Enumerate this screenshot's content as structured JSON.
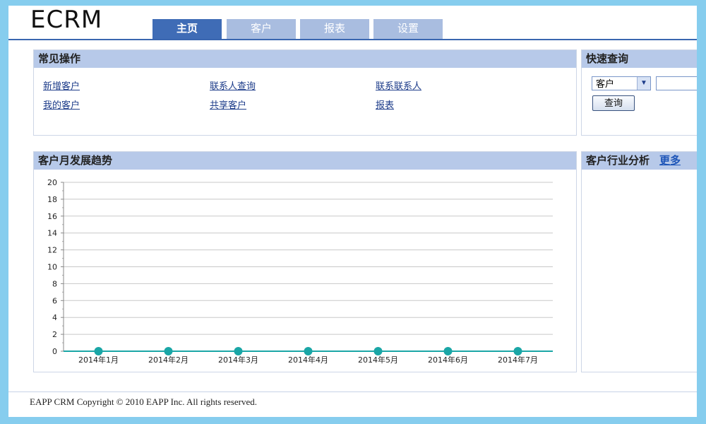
{
  "app": {
    "logo": "ECRM"
  },
  "nav": {
    "tabs": [
      {
        "label": "主页",
        "active": true
      },
      {
        "label": "客户",
        "active": false
      },
      {
        "label": "报表",
        "active": false
      },
      {
        "label": "设置",
        "active": false
      }
    ]
  },
  "common_ops": {
    "title": "常见操作",
    "links": [
      "新增客户",
      "联系人查询",
      "联系联系人",
      "我的客户",
      "共享客户",
      "报表"
    ]
  },
  "quick_query": {
    "title": "快速查询",
    "select_value": "客户",
    "button_label": "查询",
    "input_value": ""
  },
  "trend": {
    "title": "客户月发展趋势"
  },
  "industry": {
    "title": "客户行业分析",
    "more_link": "更多"
  },
  "footer": {
    "copyright": "EAPP CRM Copyright © 2010 EAPP Inc. All rights reserved."
  },
  "colors": {
    "series": "#1aa6a6",
    "accent": "#3f6cb6",
    "header": "#b7c9e9"
  },
  "chart_data": {
    "type": "line",
    "categories": [
      "2014年1月",
      "2014年2月",
      "2014年3月",
      "2014年4月",
      "2014年5月",
      "2014年6月",
      "2014年7月"
    ],
    "values": [
      0,
      0,
      0,
      0,
      0,
      0,
      0
    ],
    "yticks": [
      0,
      2,
      4,
      6,
      8,
      10,
      12,
      14,
      16,
      18,
      20
    ],
    "ylim": [
      0,
      20
    ],
    "title": "",
    "xlabel": "",
    "ylabel": "",
    "grid": true,
    "legend": "none"
  }
}
